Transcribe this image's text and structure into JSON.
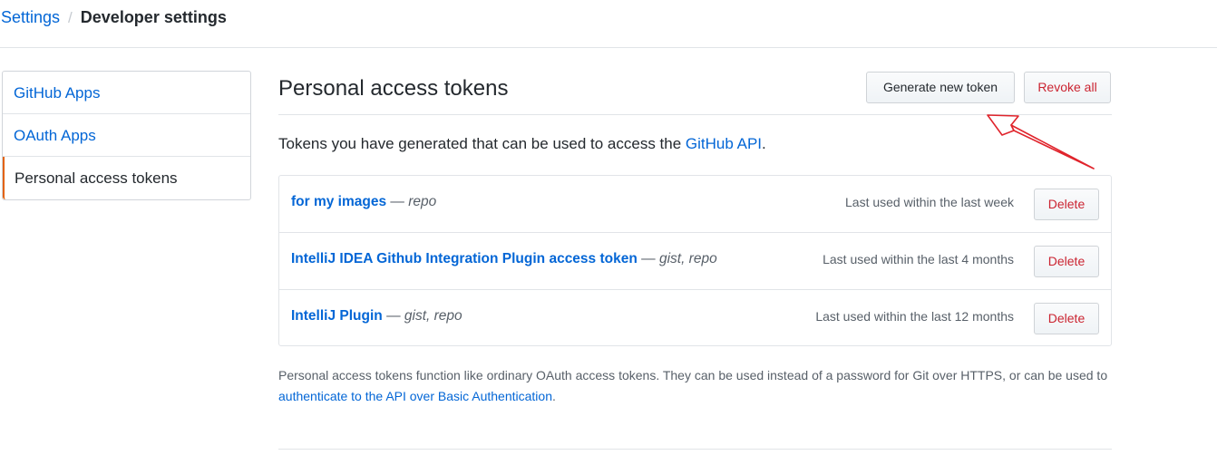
{
  "breadcrumb": {
    "root": "Settings",
    "separator": "/",
    "current": "Developer settings"
  },
  "sidebar": {
    "items": [
      {
        "label": "GitHub Apps",
        "selected": false
      },
      {
        "label": "OAuth Apps",
        "selected": false
      },
      {
        "label": "Personal access tokens",
        "selected": true
      }
    ]
  },
  "header": {
    "title": "Personal access tokens",
    "generate_label": "Generate new token",
    "revoke_label": "Revoke all"
  },
  "description": {
    "text": "Tokens you have generated that can be used to access the ",
    "link": "GitHub API",
    "suffix": "."
  },
  "tokens": [
    {
      "name": "for my images",
      "dash": " — ",
      "scopes": "repo",
      "last_used": "Last used within the last week",
      "delete_label": "Delete"
    },
    {
      "name": "IntelliJ IDEA Github Integration Plugin access token",
      "dash": " — ",
      "scopes": "gist, repo",
      "last_used": "Last used within the last 4 months",
      "delete_label": "Delete"
    },
    {
      "name": "IntelliJ Plugin",
      "dash": " — ",
      "scopes": "gist, repo",
      "last_used": "Last used within the last 12 months",
      "delete_label": "Delete"
    }
  ],
  "footnote": {
    "text": "Personal access tokens function like ordinary OAuth access tokens. They can be used instead of a password for Git over HTTPS, or can be used to ",
    "link": "authenticate to the API over Basic Authentication",
    "suffix": "."
  },
  "colors": {
    "link": "#0366d6",
    "danger": "#cb2431",
    "selected_accent": "#e36209",
    "annotation_arrow": "#e0242c"
  }
}
